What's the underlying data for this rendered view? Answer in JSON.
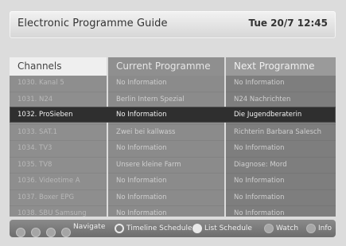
{
  "header": {
    "title": "Electronic Programme Guide",
    "datetime": "Tue 20/7 12:45"
  },
  "columns": {
    "channels": "Channels",
    "current": "Current Programme",
    "next": "Next Programme"
  },
  "rows": [
    {
      "channel": "1030. Kanal 5",
      "current": "No Information",
      "next": "No Information"
    },
    {
      "channel": "1031. N24",
      "current": "Berlin Intern Spezial",
      "next": "N24 Nachrichten"
    },
    {
      "channel": "1032. ProSieben",
      "current": "No Information",
      "next": "Die Jugendberaterin"
    },
    {
      "channel": "1033. SAT.1",
      "current": "Zwei bei kallwass",
      "next": "Richterin Barbara Salesch"
    },
    {
      "channel": "1034. TV3",
      "current": "No Information",
      "next": "No Information"
    },
    {
      "channel": "1035. TV8",
      "current": "Unsere kleine Farm",
      "next": "Diagnose: Mord"
    },
    {
      "channel": "1036. Videotime A",
      "current": "No Information",
      "next": "No Information"
    },
    {
      "channel": "1037. Boxer EPG",
      "current": "No Information",
      "next": "No Information"
    },
    {
      "channel": "1038. SBU Samsung",
      "current": "No Information",
      "next": "No Information"
    }
  ],
  "selected_index": 2,
  "footer": {
    "navigate": "Navigate",
    "timeline": "Timeline Schedule",
    "list": "List Schedule",
    "watch": "Watch",
    "info": "Info"
  },
  "colors": {
    "selected_row_bg": "#2f2f2f"
  }
}
